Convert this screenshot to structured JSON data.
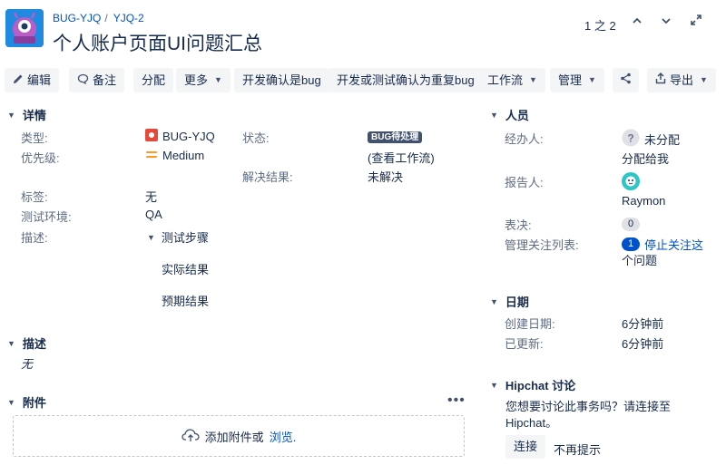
{
  "header": {
    "project_key": "BUG-YJQ",
    "issue_key": "YJQ-2",
    "title": "个人账户页面UI问题汇总",
    "pager": "1 之 2"
  },
  "toolbar": {
    "edit": "编辑",
    "comment": "备注",
    "assign": "分配",
    "more": "更多",
    "dev_confirm_bug": "开发确认是bug",
    "dev_test_confirm_dup": "开发或测试确认为重复bug",
    "workflow": "工作流",
    "admin": "管理",
    "export": "导出"
  },
  "details": {
    "section_title": "详情",
    "type_label": "类型:",
    "type_value": "BUG-YJQ",
    "priority_label": "优先级:",
    "priority_value": "Medium",
    "status_label": "状态:",
    "status_value": "BUG待处理",
    "view_workflow": "(查看工作流)",
    "resolution_label": "解决结果:",
    "resolution_value": "未解决",
    "tags_label": "标签:",
    "tags_value": "无",
    "env_label": "测试环境:",
    "env_value": "QA",
    "desc_label": "描述:",
    "desc_steps": "测试步骤",
    "desc_actual": "实际结果",
    "desc_expected": "预期结果"
  },
  "description": {
    "section_title": "描述",
    "value": "无"
  },
  "attachments": {
    "section_title": "附件",
    "drop_text": "添加附件或",
    "browse": "浏览."
  },
  "people": {
    "section_title": "人员",
    "assignee_label": "经办人:",
    "assignee_value": "未分配",
    "assign_to_me": "分配给我",
    "reporter_label": "报告人:",
    "reporter_value": "Raymon",
    "votes_label": "表决:",
    "votes_value": "0",
    "watchers_label": "管理关注列表:",
    "watchers_count": "1",
    "watchers_text_1": "停止关注这",
    "watchers_text_2": "个问题"
  },
  "dates": {
    "section_title": "日期",
    "created_label": "创建日期:",
    "created_value": "6分钟前",
    "updated_label": "已更新:",
    "updated_value": "6分钟前"
  },
  "hipchat": {
    "section_title": "Hipchat 讨论",
    "text_1": "您想要讨论此事务吗？请连接至",
    "text_2": "Hipchat。",
    "connect": "连接",
    "dismiss": "不再提示"
  },
  "colors": {
    "link": "#0052cc",
    "bug_icon": "#e5493a",
    "priority": "#ff991f",
    "project_avatar": "#1f8ae0",
    "button_bg": "#f4f5f7",
    "status_badge": "#42526e"
  },
  "icons": [
    "project-avatar",
    "chevron-up-icon",
    "chevron-down-icon",
    "expand-icon",
    "pencil-icon",
    "comment-icon",
    "share-icon",
    "export-icon",
    "bug-icon",
    "priority-medium-icon",
    "unknown-user-icon",
    "user-avatar",
    "cloud-upload-icon",
    "more-icon"
  ]
}
